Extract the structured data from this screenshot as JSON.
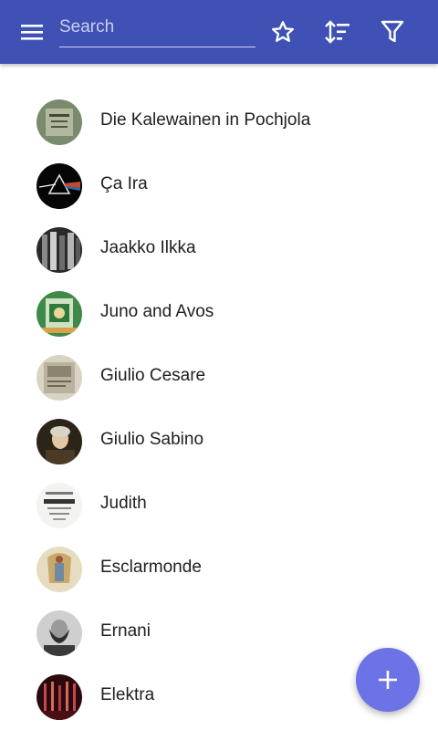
{
  "toolbar": {
    "search_placeholder": "Search",
    "icons": [
      "menu-icon",
      "star-icon",
      "sort-icon",
      "filter-icon"
    ],
    "background": "#3f51b5"
  },
  "items": [
    {
      "title": "Die Kalewainen in Pochjola"
    },
    {
      "title": "Ça Ira"
    },
    {
      "title": "Jaakko Ilkka"
    },
    {
      "title": "Juno and Avos"
    },
    {
      "title": "Giulio Cesare"
    },
    {
      "title": "Giulio Sabino"
    },
    {
      "title": "Judith"
    },
    {
      "title": "Esclarmonde"
    },
    {
      "title": "Ernani"
    },
    {
      "title": "Elektra"
    }
  ],
  "fab": {
    "icon": "plus-icon",
    "color": "#6c73e6"
  }
}
